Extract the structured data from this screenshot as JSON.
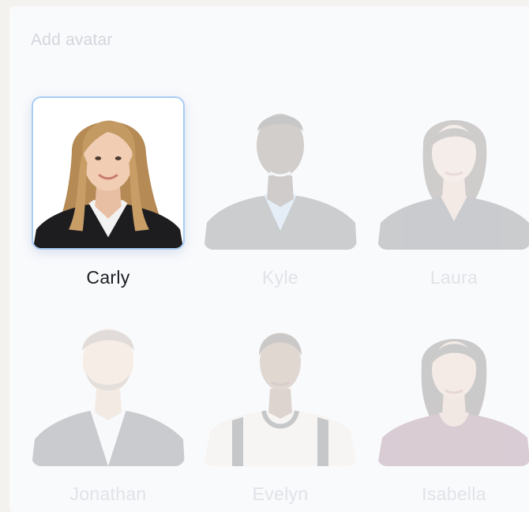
{
  "picker": {
    "title": "Add avatar",
    "selected": "Carly",
    "avatars": [
      {
        "name": "Carly",
        "icon": "avatar-photo-carly"
      },
      {
        "name": "Kyle",
        "icon": "avatar-photo-kyle"
      },
      {
        "name": "Laura",
        "icon": "avatar-photo-laura"
      },
      {
        "name": "Jonathan",
        "icon": "avatar-photo-jonathan"
      },
      {
        "name": "Evelyn",
        "icon": "avatar-photo-evelyn"
      },
      {
        "name": "Isabella",
        "icon": "avatar-photo-isabella"
      }
    ]
  },
  "colors": {
    "selection_border": "#a9ccf5",
    "panel_background": "#f9fafc",
    "frame_background": "#f4f2ee"
  }
}
